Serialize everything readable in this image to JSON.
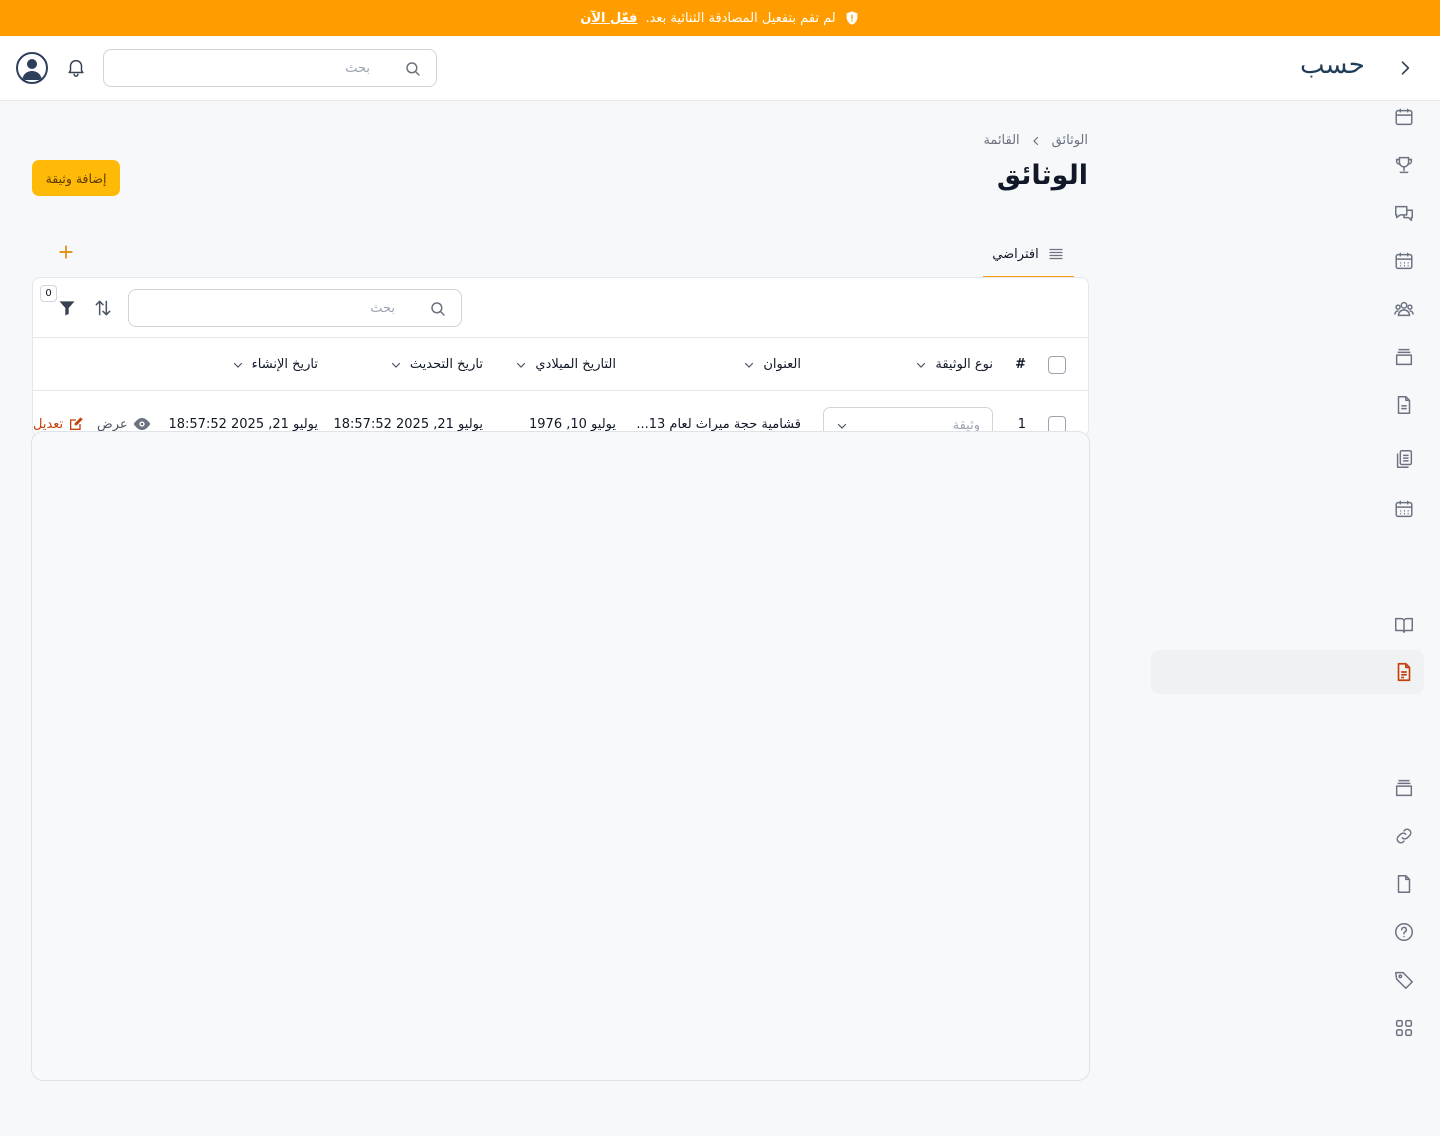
{
  "banner": {
    "message": "لم تقم بتفعيل المصادقة الثنائية بعد.",
    "action": "فعّل الآن",
    "icon": "shield-alert-icon"
  },
  "header": {
    "logo": "حسب",
    "search_placeholder": "بحث",
    "icons": [
      "user-avatar-icon",
      "bell-icon",
      "search-icon",
      "chevron-right-icon"
    ]
  },
  "sidebar": {
    "items": [
      {
        "icon": "calendar-icon",
        "active": false
      },
      {
        "icon": "trophy-icon",
        "active": false
      },
      {
        "icon": "chat-icon",
        "active": false
      },
      {
        "icon": "calendar-grid-icon",
        "active": false
      },
      {
        "icon": "users-icon",
        "active": false
      },
      {
        "icon": "archive-icon",
        "active": false
      },
      {
        "icon": "document-icon",
        "active": false
      },
      {
        "icon": "clipboard-icon",
        "active": false
      },
      {
        "icon": "calendar-grid-icon",
        "active": false
      },
      {
        "icon": "book-icon",
        "active": false
      },
      {
        "icon": "document-text-icon",
        "active": true
      },
      {
        "icon": "archive-icon",
        "active": false
      },
      {
        "icon": "link-icon",
        "active": false
      },
      {
        "icon": "file-icon",
        "active": false
      },
      {
        "icon": "help-icon",
        "active": false
      },
      {
        "icon": "tag-icon",
        "active": false
      },
      {
        "icon": "apps-icon",
        "active": false
      }
    ],
    "accent_color": "#c2410c"
  },
  "breadcrumb": {
    "root": "الوثائق",
    "current": "القائمة"
  },
  "page": {
    "title": "الوثائق",
    "add_button": "إضافة وثيقة"
  },
  "tabs": [
    {
      "label": "افتراضي",
      "icon": "list-icon",
      "active": true
    }
  ],
  "table": {
    "search_placeholder": "بحث",
    "filter_count": "0",
    "columns": {
      "index": "#",
      "type": "نوع الوثيقة",
      "title": "العنوان",
      "gregorian_date": "التاريخ الميلادي",
      "updated": "تاريخ التحديث",
      "created": "تاريخ الإنشاء"
    },
    "rows": [
      {
        "index": "1",
        "type_placeholder": "وثيقة",
        "title": "قشامية حجة ميراث لعام 13...",
        "gregorian_date": "يوليو 10, 1976",
        "updated": "يوليو 21, 2025 18:57:52",
        "created": "يوليو 21, 2025 18:57:52",
        "view_label": "عرض",
        "edit_label": "تعديل"
      }
    ]
  },
  "colors": {
    "banner": "#ff9d00",
    "primary_button": "#ffba08",
    "tab_underline": "#f59e0b",
    "edit_action": "#c2410c"
  }
}
